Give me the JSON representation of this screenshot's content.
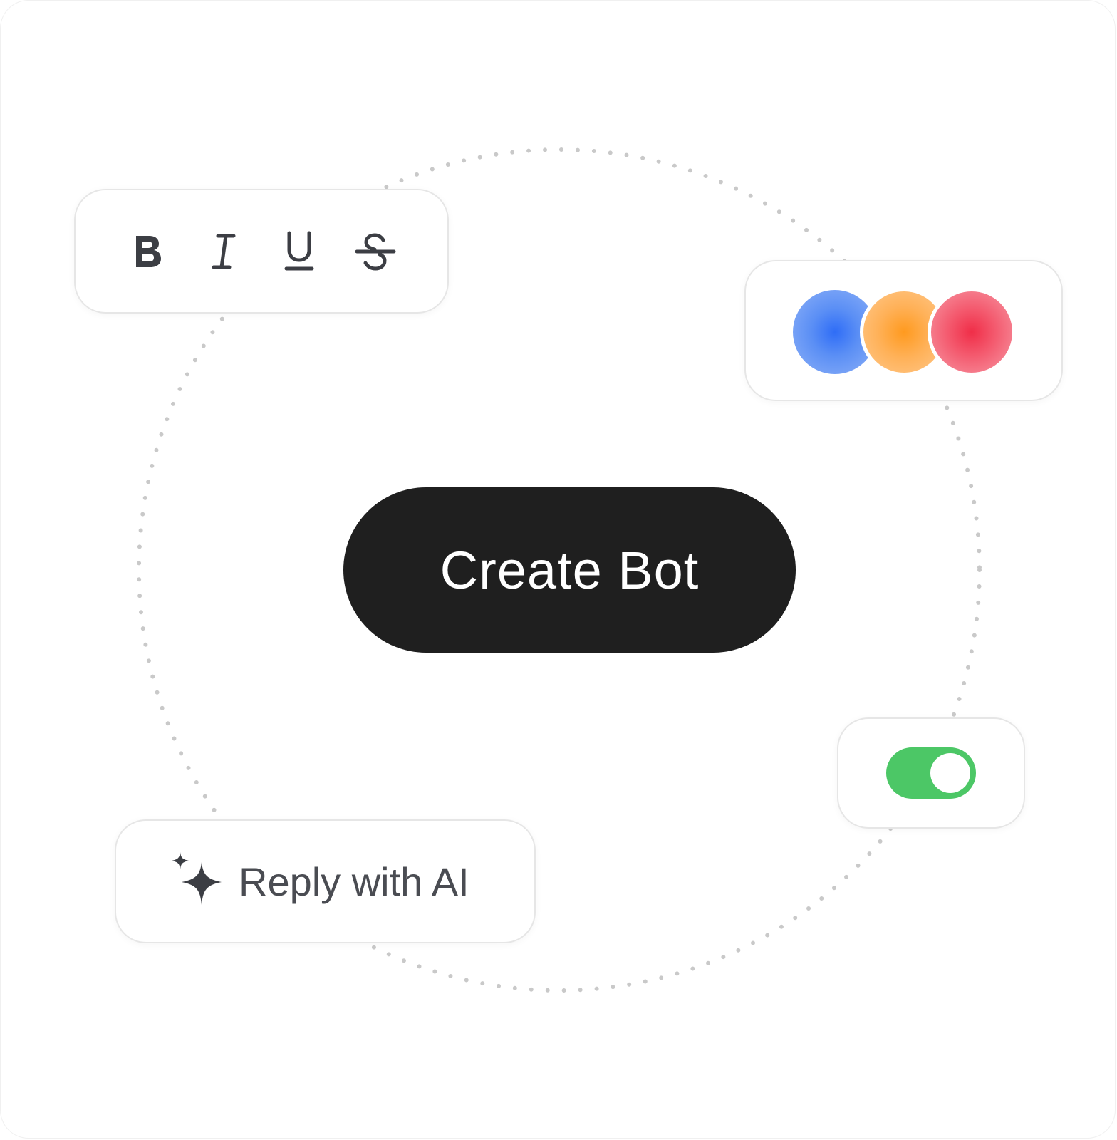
{
  "formatting_toolbar": {
    "icons": [
      "bold-icon",
      "italic-icon",
      "underline-icon",
      "strikethrough-icon"
    ]
  },
  "color_picker": {
    "swatches": [
      {
        "name": "blue",
        "color": "#2f6df6"
      },
      {
        "name": "orange",
        "color": "#ff9a1f"
      },
      {
        "name": "red",
        "color": "#f02e48"
      }
    ]
  },
  "primary_action": {
    "label": "Create Bot",
    "background": "#1f1f1f"
  },
  "toggle": {
    "state": "on",
    "color": "#4cc766"
  },
  "ai_action": {
    "label": "Reply with AI",
    "icon": "sparkle-icon"
  }
}
